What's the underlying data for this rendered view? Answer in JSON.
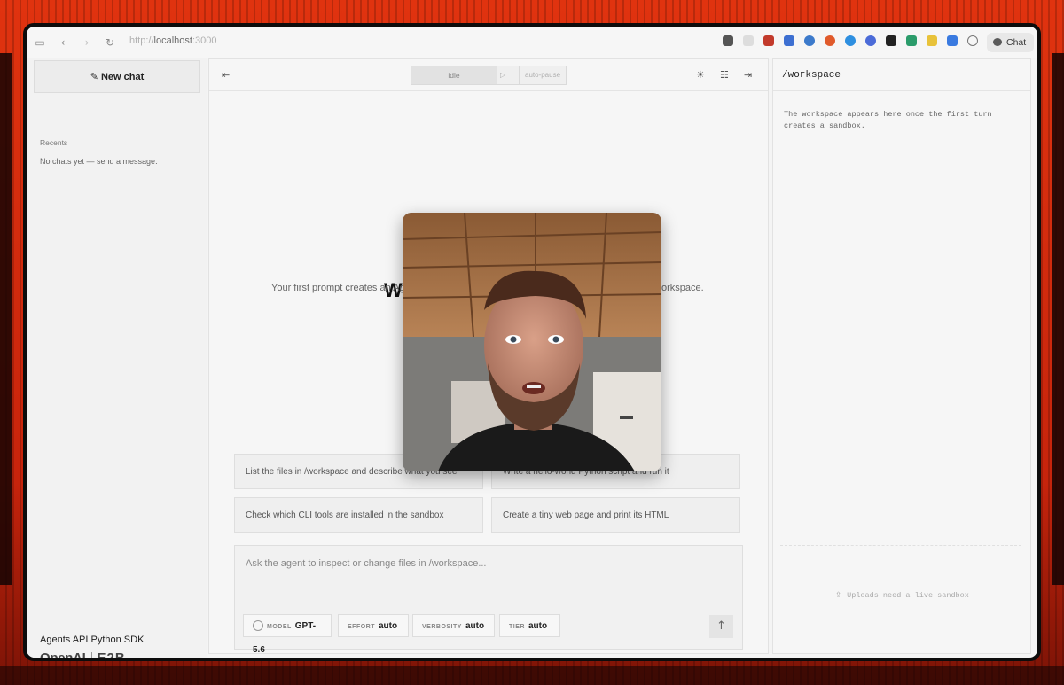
{
  "browser": {
    "url_prefix": "http://",
    "url_host": "localhost",
    "url_port": ":3000",
    "chat_button": "Chat"
  },
  "sidebar": {
    "new_chat": "New chat",
    "recents_label": "Recents",
    "empty_text": "No chats yet — send a message.",
    "sdk_label": "Agents API Python SDK",
    "brand_openai": "OpenAI",
    "brand_e2b": "E2B"
  },
  "main": {
    "status": "idle",
    "auto_pause": "auto-pause",
    "heading_visible": "W",
    "subtext_left": "Your first prompt creates an Ag",
    "subtext_right": "orkspace.",
    "suggestions": [
      "List the files in /workspace and describe what you see",
      "Write a hello-world Python script and run it",
      "Check which CLI tools are installed in the sandbox",
      "Create a tiny web page and print its HTML"
    ],
    "composer_placeholder": "Ask the agent to inspect or change files in /workspace...",
    "settings": [
      {
        "key": "MODEL",
        "value": "GPT-5.6"
      },
      {
        "key": "EFFORT",
        "value": "auto"
      },
      {
        "key": "VERBOSITY",
        "value": "auto"
      },
      {
        "key": "TIER",
        "value": "auto"
      }
    ]
  },
  "workspace": {
    "path": "/workspace",
    "message": "The workspace appears here once the first turn creates a sandbox.",
    "uploads": "Uploads need a live sandbox"
  },
  "colors": {
    "background": "#c8260f",
    "accent": "#111111"
  }
}
